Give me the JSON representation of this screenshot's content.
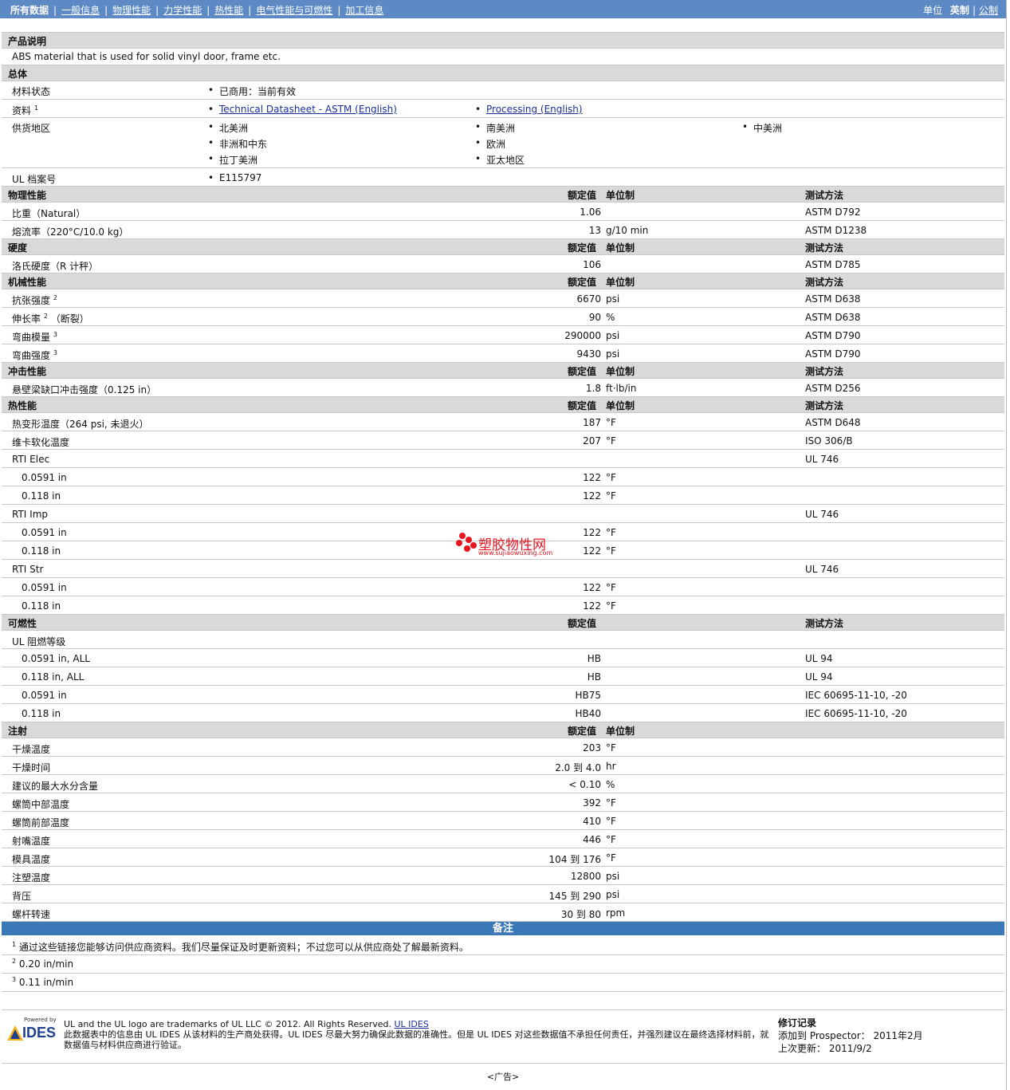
{
  "nav": {
    "items": [
      "所有数据",
      "一般信息",
      "物理性能",
      "力学性能",
      "热性能",
      "电气性能与可燃性",
      "加工信息"
    ],
    "unit_label": "单位",
    "unit_imperial": "英制",
    "unit_metric": "公制"
  },
  "product": {
    "title": "产品说明",
    "desc": "ABS material that is used for solid vinyl door, frame etc."
  },
  "general": {
    "title": "总体",
    "status_label": "材料状态",
    "status_value": "已商用：当前有效",
    "docs_label": "资料",
    "docs_sup": "1",
    "doc1": "Technical Datasheet - ASTM (English)",
    "doc2": "Processing (English)",
    "supply_label": "供货地区",
    "regions": [
      "北美洲",
      "南美洲",
      "中美洲",
      "非洲和中东",
      "欧洲",
      "拉丁美洲",
      "亚太地区"
    ],
    "ul_label": "UL 档案号",
    "ul_value": "E115797"
  },
  "col_headers": {
    "nominal": "额定值",
    "unit": "单位制",
    "test": "测试方法"
  },
  "sections": {
    "physical": {
      "title": "物理性能",
      "rows": [
        {
          "label": "比重（Natural）",
          "sup": "",
          "val": "1.06",
          "unit": "",
          "test": "ASTM D792"
        },
        {
          "label": "熔流率（220°C/10.0 kg）",
          "sup": "",
          "val": "13",
          "unit": "g/10 min",
          "test": "ASTM D1238"
        }
      ]
    },
    "hardness": {
      "title": "硬度",
      "rows": [
        {
          "label": "洛氏硬度（R 计秤）",
          "sup": "",
          "val": "106",
          "unit": "",
          "test": "ASTM D785"
        }
      ]
    },
    "mechanical": {
      "title": "机械性能",
      "rows": [
        {
          "label": "抗张强度",
          "sup": "2",
          "val": "6670",
          "unit": "psi",
          "test": "ASTM D638"
        },
        {
          "label": "伸长率",
          "sup": "2",
          "tail": "（断裂）",
          "val": "90",
          "unit": "%",
          "test": "ASTM D638"
        },
        {
          "label": "弯曲模量",
          "sup": "3",
          "val": "290000",
          "unit": "psi",
          "test": "ASTM D790"
        },
        {
          "label": "弯曲强度",
          "sup": "3",
          "val": "9430",
          "unit": "psi",
          "test": "ASTM D790"
        }
      ]
    },
    "impact": {
      "title": "冲击性能",
      "rows": [
        {
          "label": "悬壁梁缺口冲击强度（0.125 in）",
          "sup": "",
          "val": "1.8",
          "unit": "ft·lb/in",
          "test": "ASTM D256"
        }
      ]
    },
    "thermal": {
      "title": "热性能",
      "rows": [
        {
          "label": "热变形温度（264 psi, 未退火）",
          "val": "187",
          "unit": "°F",
          "test": "ASTM D648"
        },
        {
          "label": "维卡软化温度",
          "val": "207",
          "unit": "°F",
          "test": "ISO 306/B"
        },
        {
          "label": "RTI Elec",
          "val": "",
          "unit": "",
          "test": "UL 746"
        },
        {
          "label": "0.0591 in",
          "sub": true,
          "val": "122",
          "unit": "°F",
          "test": ""
        },
        {
          "label": "0.118 in",
          "sub": true,
          "val": "122",
          "unit": "°F",
          "test": ""
        },
        {
          "label": "RTI Imp",
          "val": "",
          "unit": "",
          "test": "UL 746"
        },
        {
          "label": "0.0591 in",
          "sub": true,
          "val": "122",
          "unit": "°F",
          "test": ""
        },
        {
          "label": "0.118 in",
          "sub": true,
          "val": "122",
          "unit": "°F",
          "test": ""
        },
        {
          "label": "RTI Str",
          "val": "",
          "unit": "",
          "test": "UL 746"
        },
        {
          "label": "0.0591 in",
          "sub": true,
          "val": "122",
          "unit": "°F",
          "test": ""
        },
        {
          "label": "0.118 in",
          "sub": true,
          "val": "122",
          "unit": "°F",
          "test": ""
        }
      ]
    },
    "flammability": {
      "title": "可燃性",
      "rows": [
        {
          "label": "UL 阻燃等级",
          "val": "",
          "unit": "",
          "test": ""
        },
        {
          "label": "0.0591 in, ALL",
          "sub": true,
          "val": "HB",
          "unit": "",
          "test": "UL 94"
        },
        {
          "label": "0.118 in, ALL",
          "sub": true,
          "val": "HB",
          "unit": "",
          "test": "UL 94"
        },
        {
          "label": "0.0591 in",
          "sub": true,
          "val": "HB75",
          "unit": "",
          "test": "IEC 60695-11-10, -20"
        },
        {
          "label": "0.118 in",
          "sub": true,
          "val": "HB40",
          "unit": "",
          "test": "IEC 60695-11-10, -20"
        }
      ]
    },
    "injection": {
      "title": "注射",
      "rows": [
        {
          "label": "干燥温度",
          "val": "203",
          "unit": "°F"
        },
        {
          "label": "干燥时间",
          "val": "2.0 到  4.0",
          "unit": "hr"
        },
        {
          "label": "建议的最大水分含量",
          "val": "< 0.10",
          "unit": "%"
        },
        {
          "label": "螺筒中部温度",
          "val": "392",
          "unit": "°F"
        },
        {
          "label": "螺筒前部温度",
          "val": "410",
          "unit": "°F"
        },
        {
          "label": "射嘴温度",
          "val": "446",
          "unit": "°F"
        },
        {
          "label": "模具温度",
          "val": "104 到  176",
          "unit": "°F"
        },
        {
          "label": "注塑温度",
          "val": "12800",
          "unit": "psi"
        },
        {
          "label": "背压",
          "val": "145 到  290",
          "unit": "psi"
        },
        {
          "label": "螺杆转速",
          "val": "30 到  80",
          "unit": "rpm"
        }
      ]
    }
  },
  "notes": {
    "title": "备注",
    "items": [
      {
        "sup": "1",
        "text": "通过这些链接您能够访问供应商资料。我们尽量保证及时更新资料；不过您可以从供应商处了解最新资料。"
      },
      {
        "sup": "2",
        "text": "0.20 in/min"
      },
      {
        "sup": "3",
        "text": "0.11 in/min"
      }
    ]
  },
  "footer": {
    "powered": "Powered by",
    "logo": "IDES",
    "line1": "UL and the UL logo are trademarks of UL LLC © 2012. All Rights Reserved.",
    "line1_link": "UL IDES",
    "line2": "此数据表中的信息由  UL IDES 从该材料的生产商处获得。UL IDES 尽最大努力确保此数据的准确性。但是  UL IDES 对这些数据值不承担任何责任，并强烈建议在最终选择材料前，就数据值与材料供应商进行验证。",
    "rev_title": "修订记录",
    "rev_added": "添加到  Prospector：  2011年2月",
    "rev_updated": "上次更新：  2011/9/2"
  },
  "ad": "<广告>",
  "watermark": {
    "name": "塑胶物性网",
    "url": "www.sujiaowuxing.com"
  }
}
